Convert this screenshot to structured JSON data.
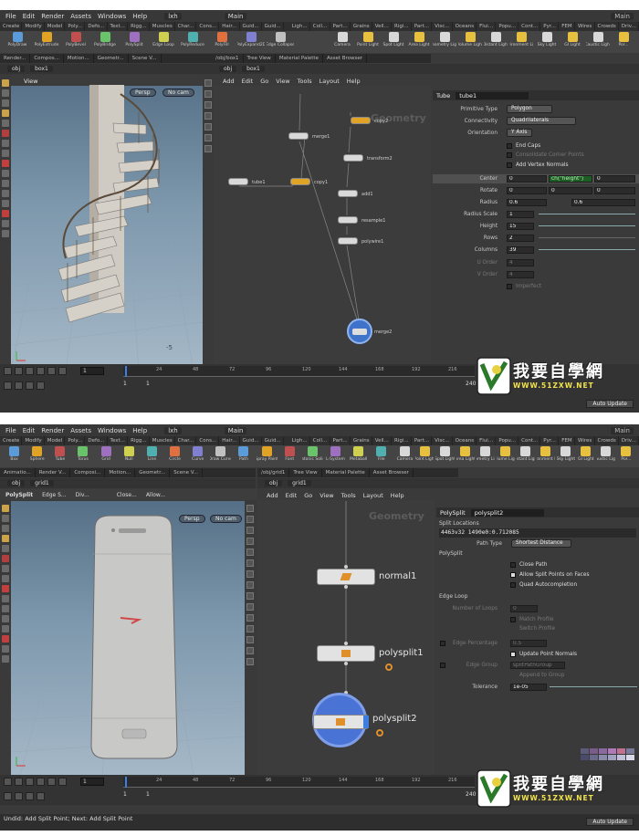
{
  "screen1": {
    "menu": [
      "File",
      "Edit",
      "Render",
      "Assets",
      "Windows",
      "Help"
    ],
    "app_field": "lxh",
    "desktop": "Main",
    "desktop_right": "Main",
    "shelf_tabs_left": [
      "Create",
      "Modify",
      "Model",
      "Poly...",
      "Defo...",
      "Text...",
      "Rigg...",
      "Muscles",
      "Char...",
      "Cons...",
      "Hair...",
      "Guid...",
      "Guid..."
    ],
    "shelf_tabs_right": [
      "Ligh...",
      "Coll...",
      "Part...",
      "Grains",
      "Vell...",
      "Rigi...",
      "Part...",
      "Visc...",
      "Oceans",
      "Flui...",
      "Popu...",
      "Cont...",
      "Pyr...",
      "FEM",
      "Wires",
      "Crowds",
      "Driv..."
    ],
    "tools_left": [
      "PolyDraw",
      "PolyExtrude",
      "PolyBevel",
      "PolyBridge",
      "PolySplit",
      "Edge Loop",
      "PolyReduce",
      "PolyFill",
      "PolyExpand2D",
      "Edge Collapse"
    ],
    "tools_right": [
      "Camera",
      "Point Light",
      "Spot Light",
      "Area Light",
      "Geometry Light",
      "Volume Light",
      "Distant Light",
      "Environment Light",
      "Sky Light",
      "GI Light",
      "Caustic Light",
      "Por..."
    ],
    "pane_tabs_left": [
      "Render...",
      "Compos...",
      "Motion...",
      "Geometr...",
      "Scene V..."
    ],
    "pane_tabs_mid": [
      "/obj/box1",
      "Tree View",
      "Material Palette",
      "Asset Browser"
    ],
    "path": [
      "obj",
      "box1"
    ],
    "viewport_title": "View",
    "persp": "Persp",
    "cam": "No cam",
    "net_menu": [
      "Add",
      "Edit",
      "Go",
      "View",
      "Tools",
      "Layout",
      "Help"
    ],
    "geo_label": "Geometry",
    "nodes": {
      "merge1": "merge1",
      "tube1": "tube1",
      "copy1": "copy1",
      "copy2": "copy2",
      "transform2": "transform2",
      "add1": "add1",
      "resample1": "resample1",
      "polywire1": "polywire1",
      "merge2": "merge2"
    },
    "parm_type": "Tube",
    "parm_name": "tube1",
    "parms": {
      "primitive_type_label": "Primitive Type",
      "primitive_type": "Polygon",
      "connectivity_label": "Connectivity",
      "connectivity": "Quadrilaterals",
      "orientation_label": "Orientation",
      "orientation": "Y Axis",
      "end_caps": "End Caps",
      "consolidate": "Consolidate Corner Points",
      "vertex_normals": "Add Vertex Normals",
      "center_label": "Center",
      "center_expr": "ch(\"height\")",
      "center_z": "0",
      "center_x": "0",
      "rotate_label": "Rotate",
      "rotate": [
        "0",
        "0",
        "0"
      ],
      "radius_label": "Radius",
      "radius": [
        "0.6",
        "0.6"
      ],
      "radius_scale_label": "Radius Scale",
      "radius_scale": "1",
      "height_label": "Height",
      "height": "15",
      "rows_label": "Rows",
      "rows": "2",
      "columns_label": "Columns",
      "columns": "39",
      "uorder_label": "U Order",
      "uorder": "4",
      "vorder_label": "V Order",
      "vorder": "4",
      "imperfect": "Imperfect"
    },
    "timeline": {
      "frame": "1",
      "ticks": [
        "24",
        "48",
        "72",
        "96",
        "120",
        "144",
        "168",
        "192",
        "216"
      ],
      "start": "1",
      "start2": "1",
      "end": "240",
      "end2": "240"
    },
    "auto_update": "Auto Update"
  },
  "screen2": {
    "menu": [
      "File",
      "Edit",
      "Render",
      "Assets",
      "Windows",
      "Help"
    ],
    "app_field": "lxh",
    "desktop": "Main",
    "desktop_right": "Main",
    "shelf_tabs_left": [
      "Create",
      "Modify",
      "Model",
      "Poly...",
      "Defo...",
      "Text...",
      "Rigg...",
      "Muscles",
      "Char...",
      "Cons...",
      "Hair...",
      "Guid...",
      "Guid..."
    ],
    "shelf_tabs_right": [
      "Ligh...",
      "Coll...",
      "Part...",
      "Grains",
      "Vell...",
      "Rigi...",
      "Part...",
      "Visc...",
      "Oceans",
      "Flui...",
      "Popu...",
      "Cont...",
      "Pyr...",
      "FEM",
      "Wires",
      "Crowds",
      "Driv..."
    ],
    "tools_left": [
      "Box",
      "Sphere",
      "Tube",
      "Torus",
      "Grid",
      "Null",
      "Line",
      "Circle",
      "Curve",
      "Draw Curve",
      "Path",
      "Spray Paint",
      "Font",
      "Platonic Solids",
      "L-System",
      "Metaball",
      "File"
    ],
    "tools_right": [
      "Camera",
      "Point Light",
      "Spot Light",
      "Area Light",
      "Geometry Light",
      "Volume Light",
      "Distant Light",
      "Environment Light",
      "Sky Light",
      "GI Light",
      "Caustic Light",
      "Por..."
    ],
    "pane_tabs_left": [
      "Animatio...",
      "Render V...",
      "Composi...",
      "Motion...",
      "Geometr...",
      "Scene V..."
    ],
    "pane_tabs_mid": [
      "/obj/grid1",
      "Tree View",
      "Material Palette",
      "Asset Browser"
    ],
    "path": [
      "obj",
      "grid1"
    ],
    "viewport_tool": "PolySplit",
    "viewport_opts": [
      "Edge S...",
      "Div...",
      "Close...",
      "Allow..."
    ],
    "persp": "Persp",
    "cam": "No cam",
    "net_menu": [
      "Add",
      "Edit",
      "Go",
      "View",
      "Tools",
      "Layout",
      "Help"
    ],
    "geo_label": "Geometry",
    "nodes": {
      "normal1": "normal1",
      "polysplit1": "polysplit1",
      "polysplit2": "polysplit2"
    },
    "parm_type": "PolySplit",
    "parm_name": "polysplit2",
    "parms": {
      "split_locations_label": "Split Locations",
      "split_locations": "4463v32 1490e0:0.712085",
      "path_type_label": "Path Type",
      "path_type": "Shortest Distance",
      "polysplit_section": "PolySplit",
      "close_path": "Close Path",
      "allow_split": "Allow Split Points on Faces",
      "quad_auto": "Quad Autocompletion",
      "edge_loop_section": "Edge Loop",
      "num_loops_label": "Number of Loops",
      "num_loops": "0",
      "match_profile": "Match Profile",
      "switch_profile": "Switch Profile",
      "edge_pct_label": "Edge Percentage",
      "edge_pct": "0.5",
      "update_normals": "Update Point Normals",
      "edge_group_label": "Edge Group",
      "edge_group": "splitPathGroup",
      "append_group": "Append to Group",
      "tolerance_label": "Tolerance",
      "tolerance": "1e-05"
    },
    "timeline": {
      "frame": "1",
      "ticks": [
        "24",
        "48",
        "72",
        "96",
        "120",
        "144",
        "168",
        "192",
        "216"
      ],
      "start": "1",
      "start2": "1",
      "end": "240",
      "end2": "240"
    },
    "status": "Undid: Add Split Point; Next: Add Split Point",
    "auto_update": "Auto Update"
  },
  "watermark": {
    "text": "我要自學網",
    "url": "WWW.51ZXW.NET"
  },
  "colors": {
    "node_gray": "#d9d9d9",
    "node_orange": "#e0a326",
    "selected": "#4a7fd6",
    "sky_top": "#556f86",
    "sky_bottom": "#a5b8c7"
  }
}
